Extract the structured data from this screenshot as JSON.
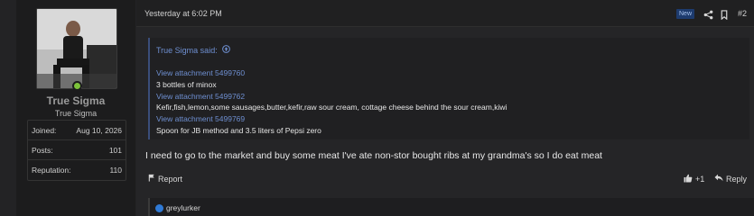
{
  "user": {
    "name": "True Sigma",
    "title": "True Sigma",
    "stats": [
      {
        "label": "Joined:",
        "value": "Aug 10, 2026"
      },
      {
        "label": "Posts:",
        "value": "101"
      },
      {
        "label": "Reputation:",
        "value": "110"
      }
    ],
    "online_color": "#7cc23a"
  },
  "post": {
    "date": "Yesterday at 6:02 PM",
    "new_badge": "New",
    "number": "#2",
    "quote": {
      "author_line": "True Sigma said:",
      "lines": [
        {
          "kind": "link",
          "text": "View attachment 5499760"
        },
        {
          "kind": "text",
          "text": "3 bottles of minox"
        },
        {
          "kind": "link",
          "text": "View attachment 5499762"
        },
        {
          "kind": "text",
          "text": "Kefir,fish,lemon,some sausages,butter,kefir,raw sour cream, cottage cheese behind the sour cream,kiwi"
        },
        {
          "kind": "link",
          "text": "View attachment 5499769"
        },
        {
          "kind": "text",
          "text": "Spoon for JB method and 3.5 liters of Pepsi zero"
        }
      ]
    },
    "message": "I need to go to the market and buy some meat I've ate non-stor bought ribs at my grandma's so I do eat meat",
    "actions": {
      "report": "Report",
      "like": "+1",
      "reply": "Reply"
    },
    "reactions": {
      "users": "greylurker"
    }
  },
  "colors": {
    "link": "#6e8fd1",
    "badge_bg": "#1d3b6e",
    "like": "#2f7ad6"
  }
}
